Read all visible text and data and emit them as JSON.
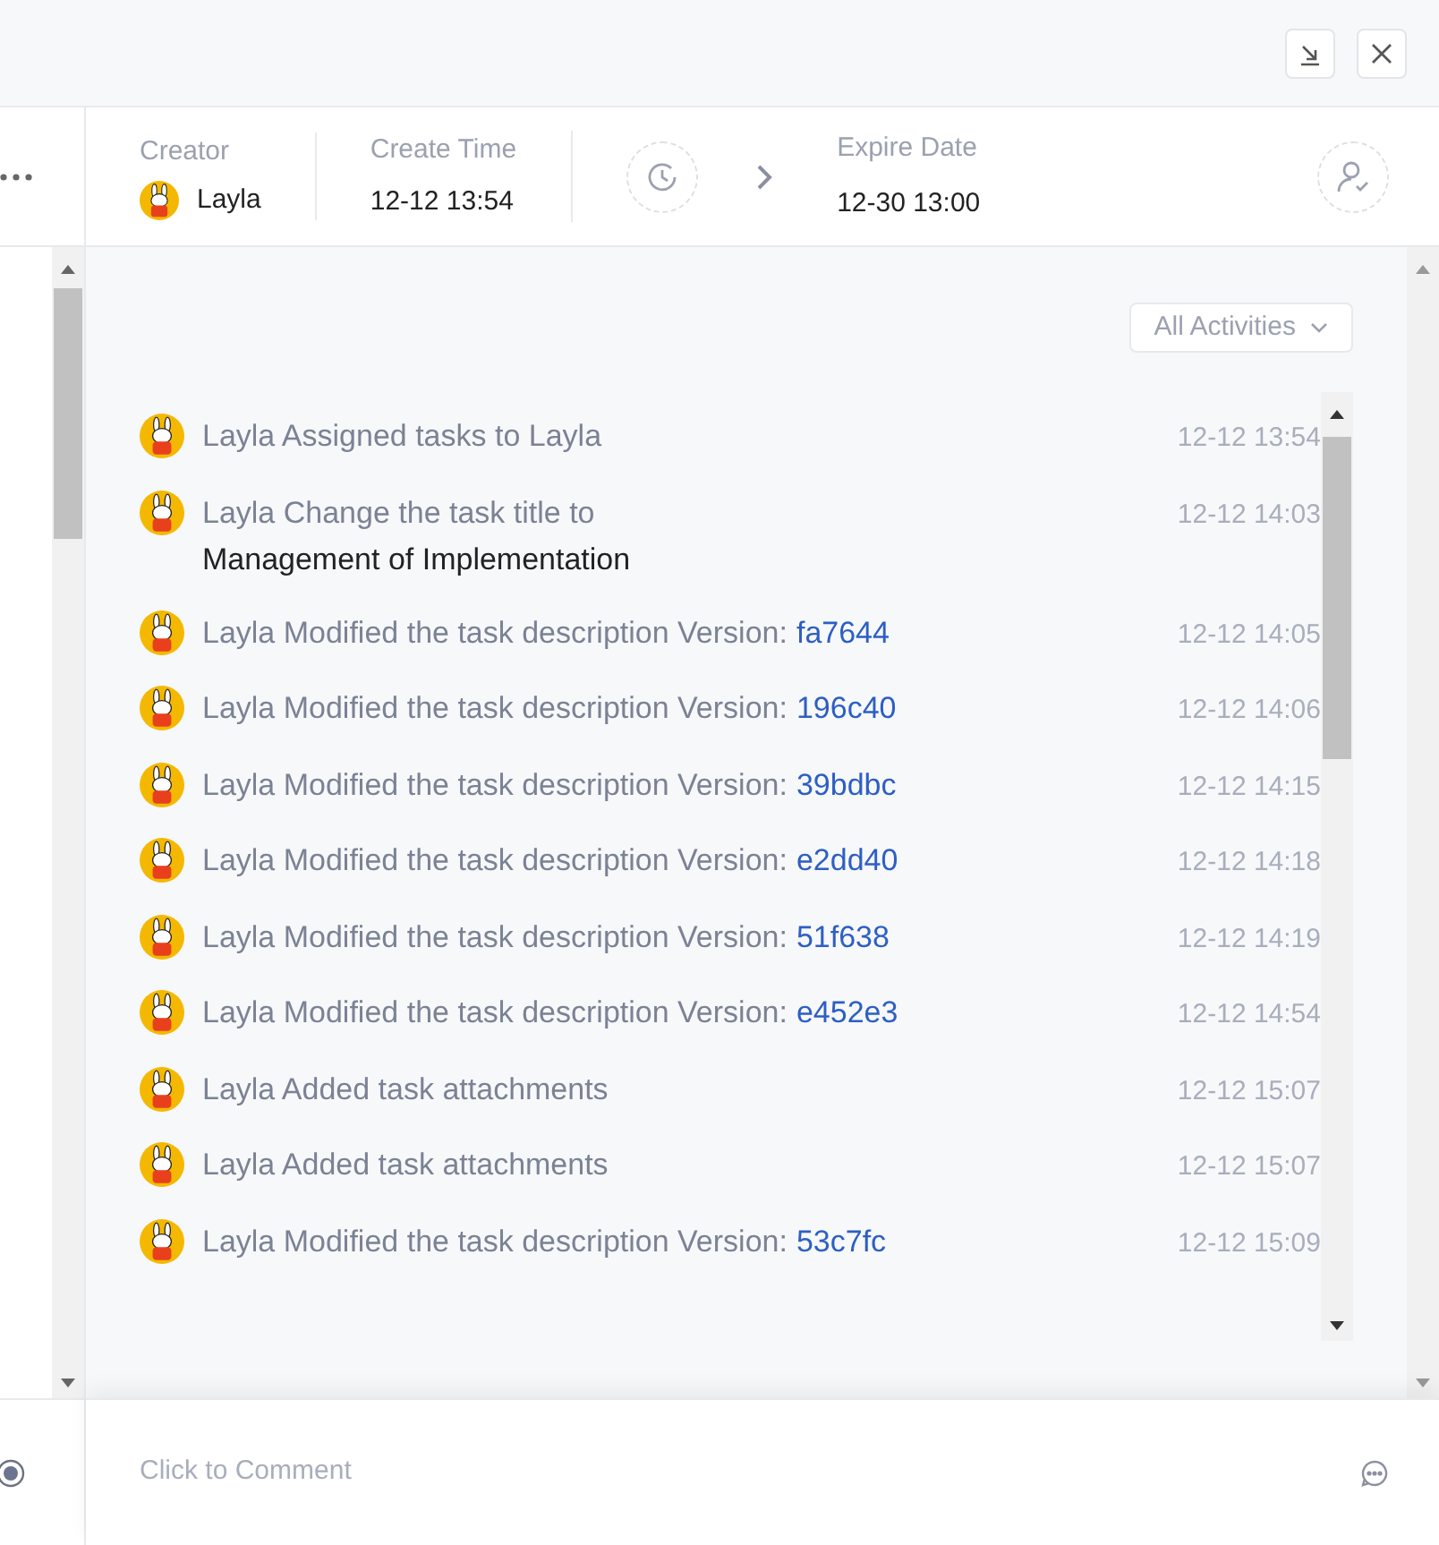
{
  "header": {
    "creator_label": "Creator",
    "creator_name": "Layla",
    "create_time_label": "Create Time",
    "create_time": "12-12 13:54",
    "expire_label": "Expire Date",
    "expire_date": "12-30 13:00"
  },
  "filter": {
    "label": "All Activities"
  },
  "activities": [
    {
      "text": "Layla Assigned tasks to Layla",
      "time": "12-12 13:54"
    },
    {
      "text": "Layla Change the task title to",
      "detail": "Management of Implementation",
      "time": "12-12 14:03"
    },
    {
      "text": "Layla Modified the task description Version:",
      "link": "fa7644",
      "time": "12-12 14:05"
    },
    {
      "text": "Layla Modified the task description Version:",
      "link": "196c40",
      "time": "12-12 14:06"
    },
    {
      "text": "Layla Modified the task description Version:",
      "link": "39bdbc",
      "time": "12-12 14:15"
    },
    {
      "text": "Layla Modified the task description Version:",
      "link": "e2dd40",
      "time": "12-12 14:18"
    },
    {
      "text": "Layla Modified the task description Version:",
      "link": "51f638",
      "time": "12-12 14:19"
    },
    {
      "text": "Layla Modified the task description Version:",
      "link": "e452e3",
      "time": "12-12 14:54"
    },
    {
      "text": "Layla Added task attachments",
      "time": "12-12 15:07"
    },
    {
      "text": "Layla Added task attachments",
      "time": "12-12 15:07"
    },
    {
      "text": "Layla Modified the task description Version:",
      "link": "53c7fc",
      "time": "12-12 15:09"
    }
  ],
  "comment": {
    "placeholder": "Click to Comment"
  }
}
